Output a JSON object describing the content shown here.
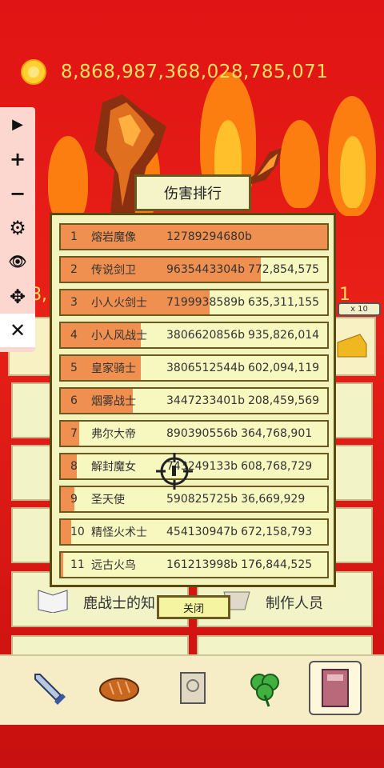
{
  "currency": {
    "value": "8,868,987,368,028,785,071",
    "icon": "gold-coin-icon"
  },
  "toolbar": {
    "play": "▶",
    "plus": "+",
    "minus": "−",
    "settings": "⚙",
    "hide": "👁",
    "move": "✥",
    "close": "✕"
  },
  "dialog": {
    "title": "伤害排行",
    "close_label": "关闭",
    "rows": [
      {
        "rank": "1",
        "name": "熔岩魔像",
        "damage": "12789294680b",
        "fill": 1.0
      },
      {
        "rank": "2",
        "name": "传说剑卫",
        "damage": "9635443304b",
        "fill": 0.75
      },
      {
        "rank": "3",
        "name": "小人火剑士",
        "damage": "7199938589b",
        "fill": 0.56
      },
      {
        "rank": "4",
        "name": "小人风战士",
        "damage": "3806620856b",
        "fill": 0.3
      },
      {
        "rank": "5",
        "name": "皇家骑士",
        "damage": "3806512544b",
        "fill": 0.3
      },
      {
        "rank": "6",
        "name": "烟雾战士",
        "damage": "3447233401b",
        "fill": 0.27
      },
      {
        "rank": "7",
        "name": "弗尔大帝",
        "damage": "890390556b",
        "fill": 0.07
      },
      {
        "rank": "8",
        "name": "解封魔女",
        "damage": "743249133b",
        "fill": 0.06
      },
      {
        "rank": "9",
        "name": "圣天使",
        "damage": "590825725b",
        "fill": 0.05
      },
      {
        "rank": "10",
        "name": "精怪火术士",
        "damage": "454130947b",
        "fill": 0.04
      },
      {
        "rank": "11",
        "name": "远古火鸟",
        "damage": "161213998b",
        "fill": 0.01
      }
    ]
  },
  "background_rows": {
    "numbers": [
      "772,854,575",
      "635,311,155",
      "935,826,014",
      "602,094,119",
      "208,459,569",
      "364,768,901",
      "608,768,729",
      "36,669,929",
      "672,158,793",
      "176,844,525"
    ]
  },
  "background": {
    "left_number": "8,",
    "right_number": "1",
    "multiplier": "x 10",
    "card_left": "鹿战士的知",
    "card_right": "制作人员"
  },
  "bottom_nav": [
    "sword-icon",
    "bread-icon",
    "scroll-icon",
    "clover-icon",
    "book-icon"
  ]
}
